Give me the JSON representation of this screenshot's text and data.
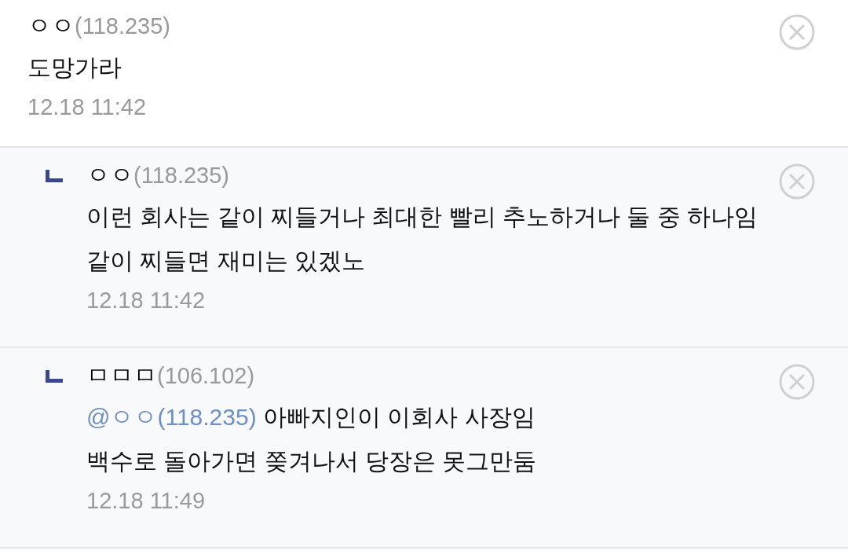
{
  "comments": [
    {
      "kind": "comment",
      "nickname": "ㅇㅇ",
      "ip": "(118.235)",
      "text": "도망가라",
      "time": "12.18 11:42"
    },
    {
      "kind": "reply",
      "nickname": "ㅇㅇ",
      "ip": "(118.235)",
      "text": "이런 회사는 같이 찌들거나 최대한 빨리 추노하거나 둘 중 하나임\n같이 찌들면 재미는 있겠노",
      "time": "12.18 11:42"
    },
    {
      "kind": "reply",
      "nickname": "ㅁㅁㅁ",
      "ip": "(106.102)",
      "mention": "@ㅇㅇ(118.235)",
      "text": "아빠지인이 이회사 사장임\n백수로 돌아가면 쫒겨나서 당장은 못그만둠",
      "time": "12.18 11:49"
    }
  ]
}
